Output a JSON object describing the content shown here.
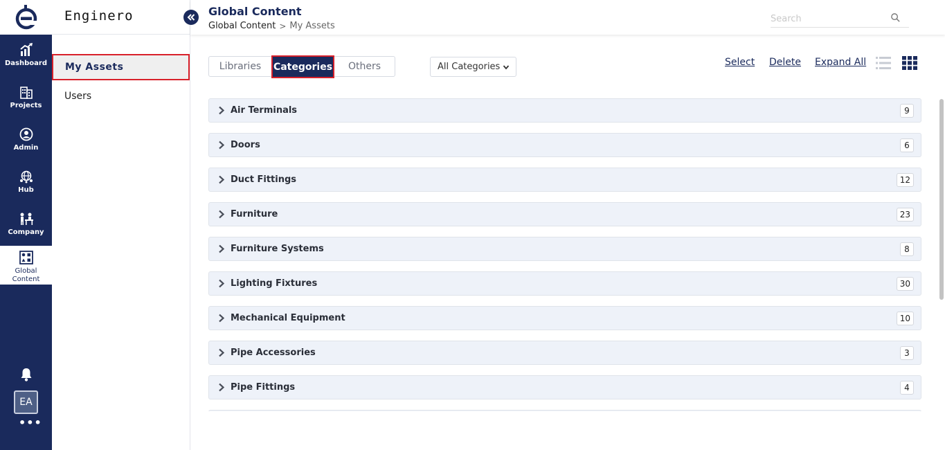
{
  "rail": {
    "logo_icon": "enginero-e-logo",
    "items": [
      {
        "label": "Dashboard",
        "icon": "chart-growth-icon"
      },
      {
        "label": "Projects",
        "icon": "buildings-icon"
      },
      {
        "label": "Admin",
        "icon": "user-circle-icon"
      },
      {
        "label": "Hub",
        "icon": "globe-person-icon"
      },
      {
        "label": "Company",
        "icon": "people-desk-icon"
      },
      {
        "label_line1": "Global",
        "label_line2": "Content",
        "icon": "shapes-grid-icon",
        "active": true
      }
    ],
    "avatar": "EA",
    "more": "•••"
  },
  "panel": {
    "brand": "Enginero",
    "items": [
      {
        "label": "My Assets",
        "active": true
      },
      {
        "label": "Users"
      }
    ]
  },
  "header": {
    "title": "Global Content",
    "breadcrumb": {
      "root": "Global Content",
      "separator": ">",
      "current": "My Assets"
    },
    "search_placeholder": "Search"
  },
  "tabs": [
    "Libraries",
    "Categories",
    "Others"
  ],
  "active_tab": "Categories",
  "filter": {
    "selected": "All Categories"
  },
  "actions": {
    "select": "Select",
    "delete": "Delete",
    "expand_all": "Expand All"
  },
  "categories": [
    {
      "name": "Air Terminals",
      "count": "9"
    },
    {
      "name": "Doors",
      "count": "6"
    },
    {
      "name": "Duct Fittings",
      "count": "12"
    },
    {
      "name": "Furniture",
      "count": "23"
    },
    {
      "name": "Furniture Systems",
      "count": "8"
    },
    {
      "name": "Lighting Fixtures",
      "count": "30"
    },
    {
      "name": "Mechanical Equipment",
      "count": "10"
    },
    {
      "name": "Pipe Accessories",
      "count": "3"
    },
    {
      "name": "Pipe Fittings",
      "count": "4"
    }
  ],
  "colors": {
    "navy": "#1a2a5c",
    "highlight": "#d8202a",
    "row_bg": "#eef2f9"
  }
}
